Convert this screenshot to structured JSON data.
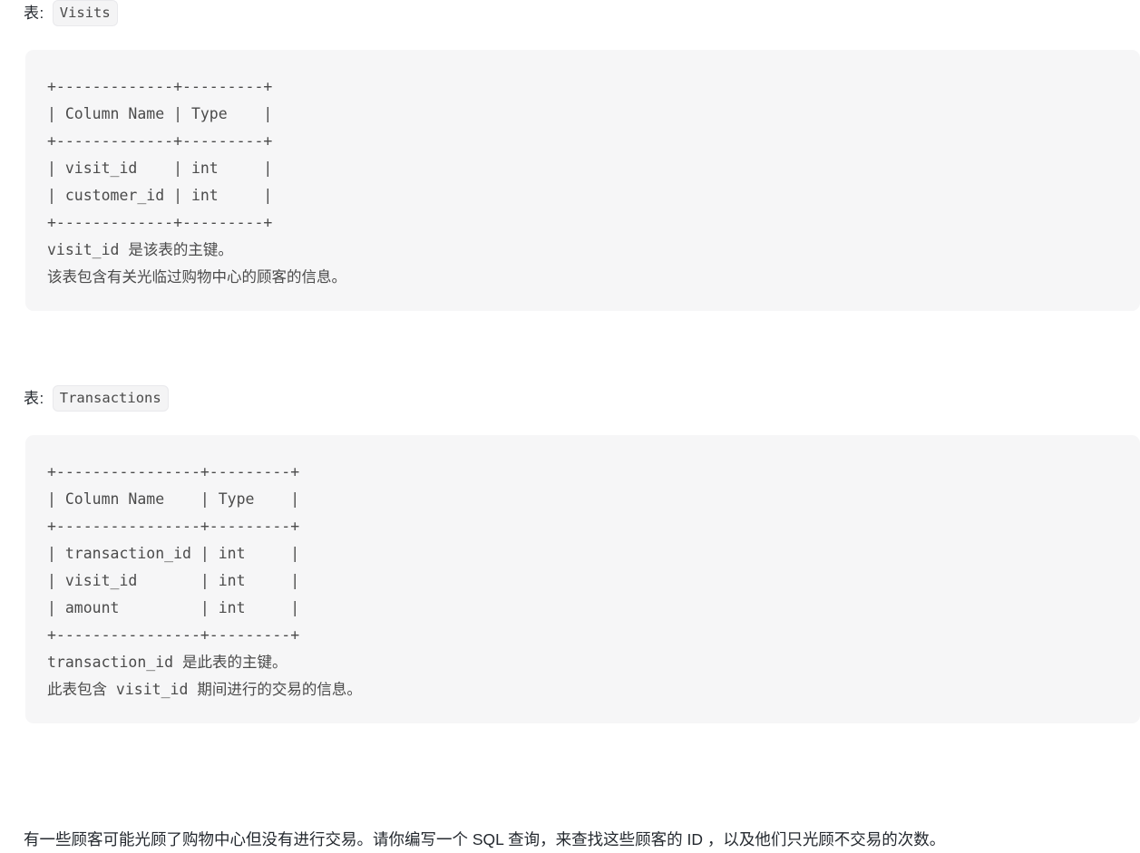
{
  "document": {
    "language": "zh-CN",
    "type": "sql-problem-statement"
  },
  "sections": [
    {
      "id": "visits",
      "caption_label": "表:",
      "caption_code": "Visits",
      "schema_block": "+-------------+---------+\n| Column Name | Type    |\n+-------------+---------+\n| visit_id    | int     |\n| customer_id | int     |\n+-------------+---------+",
      "notes": [
        "visit_id 是该表的主键。",
        "该表包含有关光临过购物中心的顾客的信息。"
      ],
      "columns": [
        {
          "name": "visit_id",
          "type": "int"
        },
        {
          "name": "customer_id",
          "type": "int"
        }
      ],
      "header_row": {
        "name": "Column Name",
        "type": "Type"
      }
    },
    {
      "id": "transactions",
      "caption_label": "表:",
      "caption_code": "Transactions",
      "schema_block": "+----------------+---------+\n| Column Name    | Type    |\n+----------------+---------+\n| transaction_id | int     |\n| visit_id       | int     |\n| amount         | int     |\n+----------------+---------+",
      "notes": [
        "transaction_id 是此表的主键。",
        "此表包含 visit_id 期间进行的交易的信息。"
      ],
      "columns": [
        {
          "name": "transaction_id",
          "type": "int"
        },
        {
          "name": "visit_id",
          "type": "int"
        },
        {
          "name": "amount",
          "type": "int"
        }
      ],
      "header_row": {
        "name": "Column Name",
        "type": "Type"
      }
    }
  ],
  "prompt": "有一些顾客可能光顾了购物中心但没有进行交易。请你编写一个 SQL 查询，来查找这些顾客的 ID ，以及他们只光顾不交易的次数。",
  "colors": {
    "page_background": "#ffffff",
    "code_background": "#f6f6f7",
    "code_text": "#4b4b4b",
    "body_text": "#24292f",
    "badge_background": "#f4f4f5",
    "badge_border": "#e9e9ec"
  }
}
